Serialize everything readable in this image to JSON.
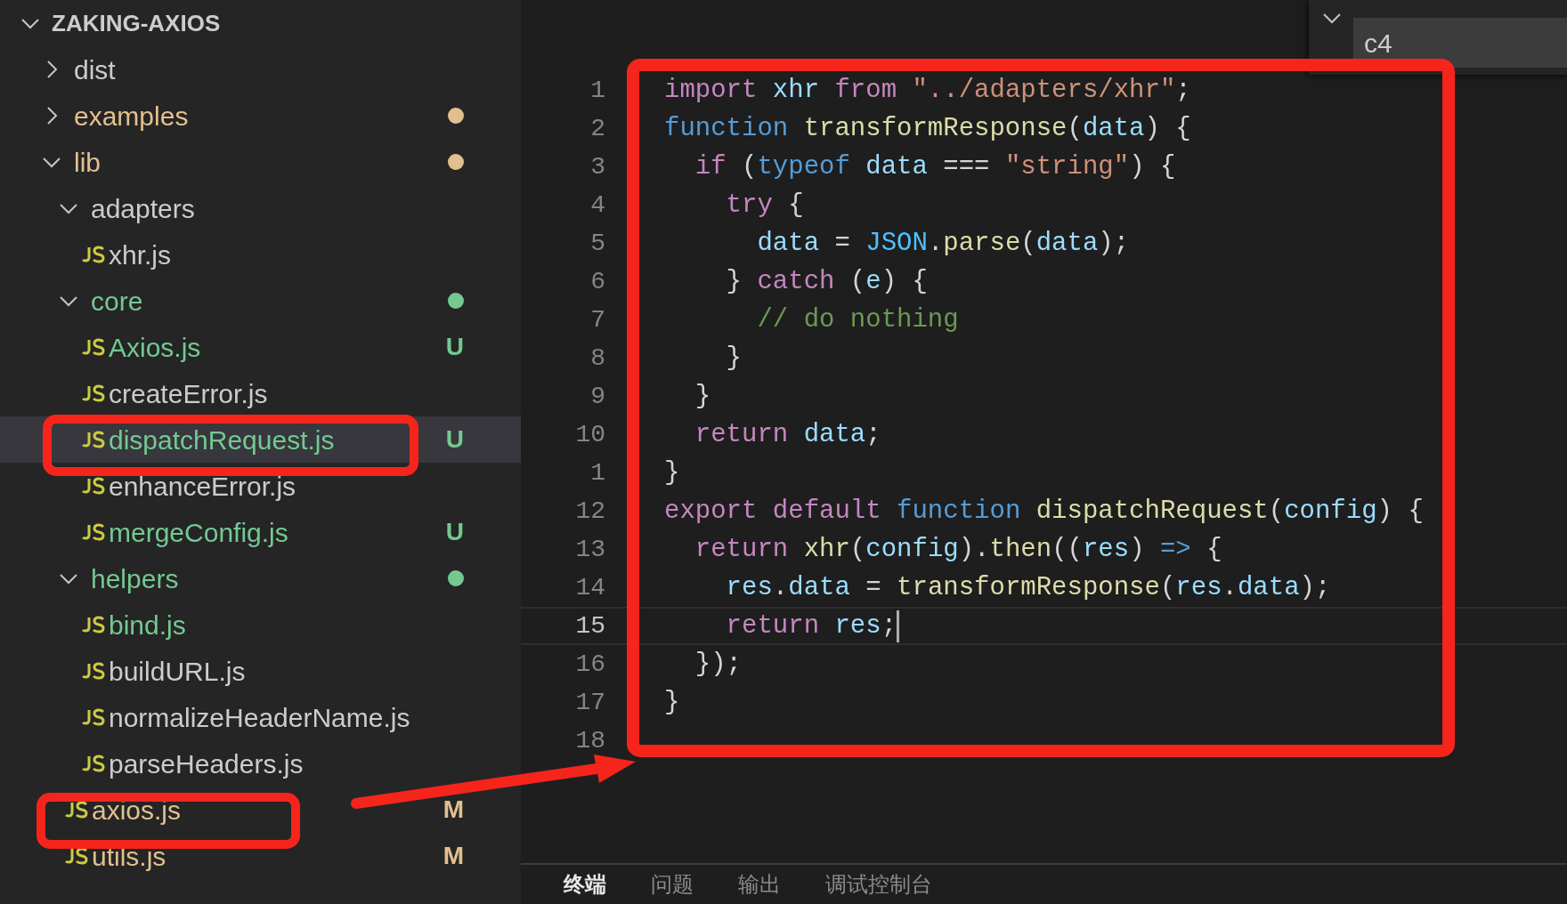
{
  "explorer": {
    "title": "ZAKING-AXIOS",
    "expanded": true,
    "items": [
      {
        "name": "dist",
        "kind": "folder",
        "expanded": false,
        "color": "#cccccc",
        "dot": false,
        "selected": false
      },
      {
        "name": "examples",
        "kind": "folder",
        "expanded": false,
        "color": "#e2c08d",
        "dot": true,
        "selected": false
      },
      {
        "name": "lib",
        "kind": "folder",
        "expanded": true,
        "color": "#e2c08d",
        "dot": true,
        "selected": false,
        "children": [
          {
            "name": "adapters",
            "kind": "folder",
            "expanded": true,
            "color": "#cccccc",
            "dot": false,
            "selected": false,
            "children": [
              {
                "name": "xhr.js",
                "kind": "file",
                "color": "#cccccc",
                "selected": false
              }
            ]
          },
          {
            "name": "core",
            "kind": "folder",
            "expanded": true,
            "color": "#73c991",
            "dot": true,
            "selected": false,
            "children": [
              {
                "name": "Axios.js",
                "kind": "file",
                "color": "#73c991",
                "badge": "U",
                "selected": false
              },
              {
                "name": "createError.js",
                "kind": "file",
                "color": "#cccccc",
                "selected": false
              },
              {
                "name": "dispatchRequest.js",
                "kind": "file",
                "color": "#73c991",
                "badge": "U",
                "selected": true
              },
              {
                "name": "enhanceError.js",
                "kind": "file",
                "color": "#cccccc",
                "selected": false
              },
              {
                "name": "mergeConfig.js",
                "kind": "file",
                "color": "#73c991",
                "badge": "U",
                "selected": false
              }
            ]
          },
          {
            "name": "helpers",
            "kind": "folder",
            "expanded": true,
            "color": "#73c991",
            "dot": true,
            "selected": false,
            "children": [
              {
                "name": "bind.js",
                "kind": "file",
                "color": "#73c991",
                "selected": false
              },
              {
                "name": "buildURL.js",
                "kind": "file",
                "color": "#cccccc",
                "selected": false
              },
              {
                "name": "normalizeHeaderName.js",
                "kind": "file",
                "color": "#cccccc",
                "selected": false
              },
              {
                "name": "parseHeaders.js",
                "kind": "file",
                "color": "#cccccc",
                "selected": false
              }
            ]
          },
          {
            "name": "axios.js",
            "kind": "file",
            "color": "#e2c08d",
            "badge": "M",
            "selected": false
          },
          {
            "name": "utils.js",
            "kind": "file",
            "color": "#e2c08d",
            "badge": "M",
            "selected": false
          }
        ]
      }
    ]
  },
  "find_widget": {
    "expanded": true,
    "value": "c4"
  },
  "editor": {
    "lines": [
      {
        "number": "1",
        "current": false,
        "tokens": [
          {
            "t": "import",
            "color": "#c586c0"
          },
          {
            "t": " xhr",
            "color": "#9cdcfe"
          },
          {
            "t": " from",
            "color": "#c586c0"
          },
          {
            "t": " \"../adapters/xhr\"",
            "color": "#ce9178"
          },
          {
            "t": ";",
            "color": "#d4d4d4"
          }
        ]
      },
      {
        "number": "2",
        "current": false,
        "tokens": [
          {
            "t": "function",
            "color": "#569cd6"
          },
          {
            "t": " transformResponse",
            "color": "#dcdcaa"
          },
          {
            "t": "(",
            "color": "#d4d4d4"
          },
          {
            "t": "data",
            "color": "#9cdcfe"
          },
          {
            "t": ") {",
            "color": "#d4d4d4"
          }
        ]
      },
      {
        "number": "3",
        "current": false,
        "tokens": [
          {
            "t": "  if",
            "color": "#c586c0"
          },
          {
            "t": " (",
            "color": "#d4d4d4"
          },
          {
            "t": "typeof",
            "color": "#569cd6"
          },
          {
            "t": " data",
            "color": "#9cdcfe"
          },
          {
            "t": " === ",
            "color": "#d4d4d4"
          },
          {
            "t": "\"string\"",
            "color": "#ce9178"
          },
          {
            "t": ") {",
            "color": "#d4d4d4"
          }
        ]
      },
      {
        "number": "4",
        "current": false,
        "tokens": [
          {
            "t": "    try",
            "color": "#c586c0"
          },
          {
            "t": " {",
            "color": "#d4d4d4"
          }
        ]
      },
      {
        "number": "5",
        "current": false,
        "tokens": [
          {
            "t": "      data",
            "color": "#9cdcfe"
          },
          {
            "t": " = ",
            "color": "#d4d4d4"
          },
          {
            "t": "JSON",
            "color": "#4fc1ff"
          },
          {
            "t": ".",
            "color": "#d4d4d4"
          },
          {
            "t": "parse",
            "color": "#dcdcaa"
          },
          {
            "t": "(",
            "color": "#d4d4d4"
          },
          {
            "t": "data",
            "color": "#9cdcfe"
          },
          {
            "t": ");",
            "color": "#d4d4d4"
          }
        ]
      },
      {
        "number": "6",
        "current": false,
        "tokens": [
          {
            "t": "    } ",
            "color": "#d4d4d4"
          },
          {
            "t": "catch",
            "color": "#c586c0"
          },
          {
            "t": " (",
            "color": "#d4d4d4"
          },
          {
            "t": "e",
            "color": "#9cdcfe"
          },
          {
            "t": ") {",
            "color": "#d4d4d4"
          }
        ]
      },
      {
        "number": "7",
        "current": false,
        "tokens": [
          {
            "t": "      // do nothing",
            "color": "#6a9955"
          }
        ]
      },
      {
        "number": "8",
        "current": false,
        "tokens": [
          {
            "t": "    }",
            "color": "#d4d4d4"
          }
        ]
      },
      {
        "number": "9",
        "current": false,
        "tokens": [
          {
            "t": "  }",
            "color": "#d4d4d4"
          }
        ]
      },
      {
        "number": "10",
        "current": false,
        "tokens": [
          {
            "t": "  return",
            "color": "#c586c0"
          },
          {
            "t": " data",
            "color": "#9cdcfe"
          },
          {
            "t": ";",
            "color": "#d4d4d4"
          }
        ]
      },
      {
        "number": "1",
        "current": false,
        "tokens": [
          {
            "t": "}",
            "color": "#d4d4d4"
          }
        ]
      },
      {
        "number": "12",
        "current": false,
        "tokens": [
          {
            "t": "export",
            "color": "#c586c0"
          },
          {
            "t": " default",
            "color": "#c586c0"
          },
          {
            "t": " function",
            "color": "#569cd6"
          },
          {
            "t": " dispatchRequest",
            "color": "#dcdcaa"
          },
          {
            "t": "(",
            "color": "#d4d4d4"
          },
          {
            "t": "config",
            "color": "#9cdcfe"
          },
          {
            "t": ") {",
            "color": "#d4d4d4"
          }
        ]
      },
      {
        "number": "13",
        "current": false,
        "tokens": [
          {
            "t": "  return",
            "color": "#c586c0"
          },
          {
            "t": " xhr",
            "color": "#dcdcaa"
          },
          {
            "t": "(",
            "color": "#d4d4d4"
          },
          {
            "t": "config",
            "color": "#9cdcfe"
          },
          {
            "t": ").",
            "color": "#d4d4d4"
          },
          {
            "t": "then",
            "color": "#dcdcaa"
          },
          {
            "t": "((",
            "color": "#d4d4d4"
          },
          {
            "t": "res",
            "color": "#9cdcfe"
          },
          {
            "t": ") ",
            "color": "#d4d4d4"
          },
          {
            "t": "=>",
            "color": "#569cd6"
          },
          {
            "t": " {",
            "color": "#d4d4d4"
          }
        ]
      },
      {
        "number": "14",
        "current": false,
        "tokens": [
          {
            "t": "    res",
            "color": "#9cdcfe"
          },
          {
            "t": ".",
            "color": "#d4d4d4"
          },
          {
            "t": "data",
            "color": "#9cdcfe"
          },
          {
            "t": " = ",
            "color": "#d4d4d4"
          },
          {
            "t": "transformResponse",
            "color": "#dcdcaa"
          },
          {
            "t": "(",
            "color": "#d4d4d4"
          },
          {
            "t": "res",
            "color": "#9cdcfe"
          },
          {
            "t": ".",
            "color": "#d4d4d4"
          },
          {
            "t": "data",
            "color": "#9cdcfe"
          },
          {
            "t": ");",
            "color": "#d4d4d4"
          }
        ]
      },
      {
        "number": "15",
        "current": true,
        "tokens": [
          {
            "t": "    return",
            "color": "#c586c0"
          },
          {
            "t": " res",
            "color": "#9cdcfe"
          },
          {
            "t": ";",
            "color": "#d4d4d4"
          }
        ]
      },
      {
        "number": "16",
        "current": false,
        "tokens": [
          {
            "t": "  });",
            "color": "#d4d4d4"
          }
        ]
      },
      {
        "number": "17",
        "current": false,
        "tokens": [
          {
            "t": "}",
            "color": "#d4d4d4"
          }
        ]
      },
      {
        "number": "18",
        "current": false
      }
    ]
  },
  "panel": {
    "tabs": [
      {
        "label": "终端",
        "selected": true
      },
      {
        "label": "问题",
        "selected": false
      },
      {
        "label": "输出",
        "selected": false
      },
      {
        "label": "调试控制台",
        "selected": false
      }
    ]
  }
}
